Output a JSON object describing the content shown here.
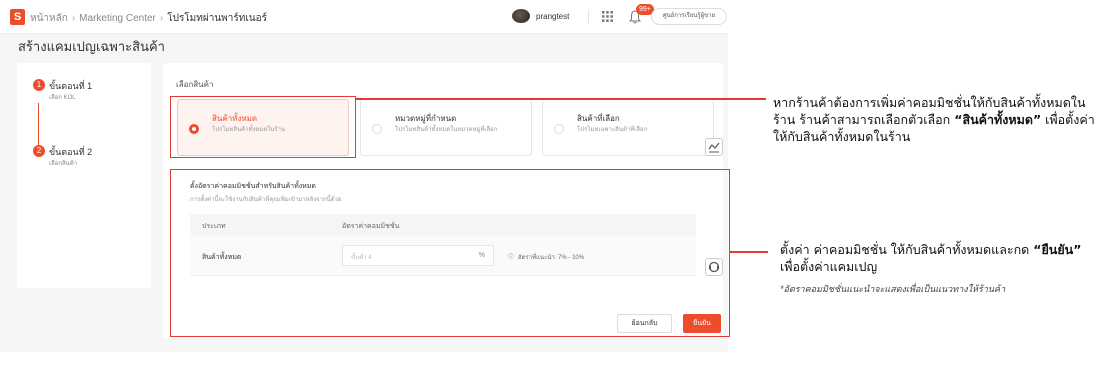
{
  "breadcrumb": {
    "home": "หน้าหลัก",
    "center": "Marketing Center",
    "current": "โปรโมทผ่านพาร์ทเนอร์"
  },
  "header": {
    "logo": "S",
    "username": "prangtest",
    "notifications": "99+",
    "help": "ศูนย์การเรียนรู้ผู้ขาย"
  },
  "page": {
    "title": "สร้างแคมเปญเฉพาะสินค้า"
  },
  "steps": [
    {
      "num": "1",
      "title": "ขั้นตอนที่ 1",
      "subtitle": "เลือก KOL"
    },
    {
      "num": "2",
      "title": "ขั้นตอนที่ 2",
      "subtitle": "เลือกสินค้า"
    }
  ],
  "select": {
    "label": "เลือกสินค้า",
    "options": [
      {
        "title": "สินค้าทั้งหมด",
        "desc": "โปรโมทสินค้าทั้งหมดในร้าน",
        "selected": true
      },
      {
        "title": "หมวดหมู่ที่กำหนด",
        "desc": "โปรโมทสินค้าทั้งหมดในหมวดหมู่ที่เลือก",
        "selected": false
      },
      {
        "title": "สินค้าที่เลือก",
        "desc": "โปรโมทเฉพาะสินค้าที่เลือก",
        "selected": false
      }
    ]
  },
  "rate": {
    "title": "ตั้งอัตราค่าคอมมิชชั่นสำหรับสินค้าทั้งหมด",
    "subtitle": "การตั้งค่านี้จะใช้งานกับสินค้าที่คุณเพิ่มเข้ามาหลังจากนี้ด้วย",
    "col_type": "ประเภท",
    "col_rate": "อัตราค่าคอมมิชชั่น",
    "row_category": "สินค้าทั้งหมด",
    "placeholder": "ขั้นต่ำ 4",
    "unit": "%",
    "hint": "อัตราที่แนะนำ: 7% - 10%"
  },
  "buttons": {
    "cancel": "ย้อนกลับ",
    "confirm": "ยืนยัน"
  },
  "annotations": {
    "a1_pre": "หากร้านค้าต้องการเพิ่มค่าคอมมิชชั่นให้กับสินค้าทั้งหมดในร้าน ร้านค้าสามารถเลือกตัวเลือก ",
    "a1_bold": "“สินค้าทั้งหมด”",
    "a1_post": " เพื่อตั้งค่าให้กับสินค้าทั้งหมดในร้าน",
    "a2_pre": "ตั้งค่า ค่าคอมมิชชั่น ให้กับสินค้าทั้งหมดและกด ",
    "a2_bold": "“ยืนยัน”",
    "a2_post": " เพื่อตั้งค่าแคมเปญ",
    "note": "*อัตราคอมมิชชั่นแนะนำจะแสดงเพื่อเป็นแนวทางให้ร้านค้า"
  },
  "colors": {
    "accent": "#ee4d2d",
    "highlight": "#e53935"
  },
  "icons": [
    "shopee-logo-icon",
    "apps-grid-icon",
    "bell-icon",
    "chart-icon",
    "headset-icon",
    "info-icon"
  ]
}
